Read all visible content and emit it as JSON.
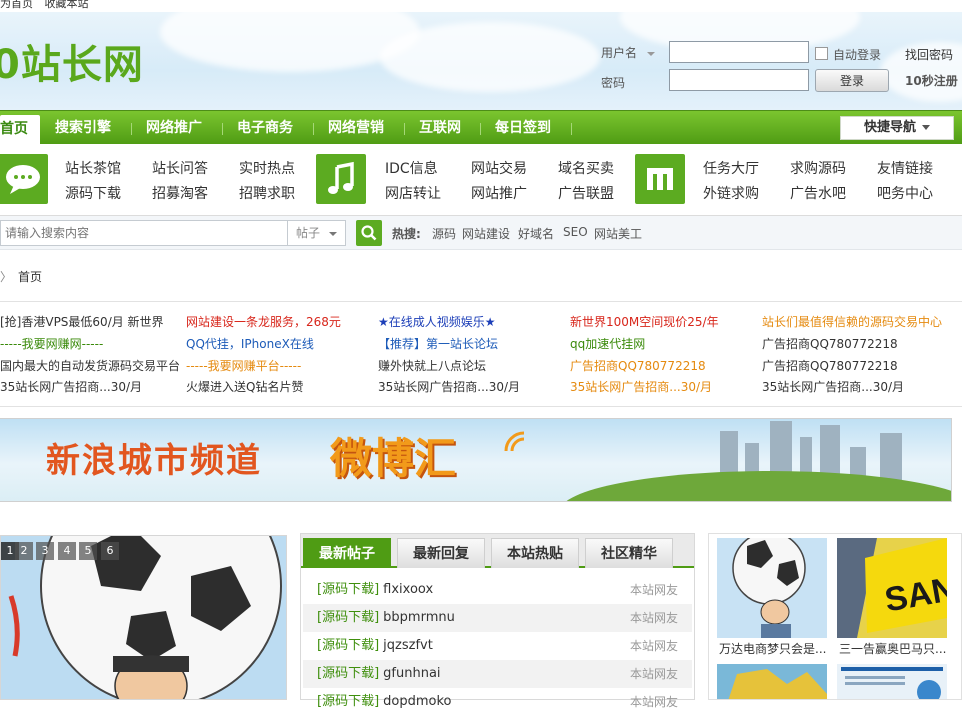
{
  "topbar": {
    "set_home": "为首页",
    "bookmark": "收藏本站"
  },
  "header": {
    "logo": "0站长网",
    "username_label": "用户名",
    "password_label": "密码",
    "remember_label": "自动登录",
    "forgot_label": "找回密码",
    "login_button": "登录",
    "register_link": "10秒注册"
  },
  "nav": {
    "items": [
      "首页",
      "搜索引擎",
      "网络推广",
      "电子商务",
      "网络营销",
      "互联网",
      "每日签到"
    ],
    "quick_nav": "快捷导航"
  },
  "categories": {
    "group1": [
      "站长茶馆",
      "站长问答",
      "实时热点",
      "源码下载",
      "招募淘客",
      "招聘求职"
    ],
    "group2": [
      "IDC信息",
      "网站交易",
      "域名买卖",
      "网店转让",
      "网站推广",
      "广告联盟"
    ],
    "group3": [
      "任务大厅",
      "求购源码",
      "友情链接",
      "外链求购",
      "广告水吧",
      "吧务中心"
    ]
  },
  "search": {
    "placeholder": "请输入搜索内容",
    "type": "帖子",
    "hot_label": "热搜:",
    "hot_links": [
      "源码",
      "网站建设",
      "好域名",
      "SEO",
      "网站美工"
    ]
  },
  "breadcrumb": {
    "home": "首页"
  },
  "ads": {
    "col1": [
      "[抢]香港VPS最低60/月 新世界",
      "-----我要网赚网-----",
      "国内最大的自动发货源码交易平台",
      "35站长网广告招商...30/月"
    ],
    "col2": [
      "网站建设一条龙服务，268元",
      "QQ代挂，IPhoneX在线",
      "-----我要网赚平台-----",
      "火爆进入送Q钻名片赞"
    ],
    "col3": [
      "★在线成人视频娱乐★",
      "【推荐】第一站长论坛",
      "赚外快就上八点论坛",
      "35站长网广告招商...30/月"
    ],
    "col4": [
      "新世界100M空间现价25/年",
      "qq加速代挂网",
      "广告招商QQ780772218",
      "35站长网广告招商...30/月"
    ],
    "col5": [
      "站长们最值得信赖的源码交易中心",
      "广告招商QQ780772218",
      "广告招商QQ780772218",
      "35站长网广告招商...30/月"
    ],
    "colors": {
      "col1": [
        "#333333",
        "#3a8a0a",
        "#333333",
        "#333333"
      ],
      "col2": [
        "#d8261b",
        "#1d5bb8",
        "#e58a0f",
        "#333333"
      ],
      "col3": [
        "#1d3fb8",
        "#1d5bb8",
        "#333333",
        "#333333"
      ],
      "col4": [
        "#d8261b",
        "#3a8a0a",
        "#e58a0f",
        "#e58a0f"
      ],
      "col5": [
        "#e58a0f",
        "#333333",
        "#333333",
        "#333333"
      ]
    }
  },
  "banner": {
    "title_left": "新浪城市频道",
    "title_right": "微博汇"
  },
  "slideshow": {
    "numbers": [
      "1",
      "2",
      "3",
      "4",
      "5",
      "6"
    ],
    "active": "1"
  },
  "posts": {
    "tabs": [
      "最新帖子",
      "最新回复",
      "本站热贴",
      "社区精华"
    ],
    "items": [
      {
        "category": "[源码下载]",
        "title": "flxixoox",
        "author": "本站网友"
      },
      {
        "category": "[源码下载]",
        "title": "bbpmrmnu",
        "author": "本站网友"
      },
      {
        "category": "[源码下载]",
        "title": "jqzszfvt",
        "author": "本站网友"
      },
      {
        "category": "[源码下载]",
        "title": "gfunhnai",
        "author": "本站网友"
      },
      {
        "category": "[源码下载]",
        "title": "dopdmoko",
        "author": "本站网友"
      }
    ]
  },
  "thumbs": {
    "captions": [
      "万达电商梦只会是...",
      "三一告赢奥巴马只..."
    ]
  },
  "colors": {
    "brand_green": "#5cab21",
    "nav_green": "#4f9c14"
  }
}
